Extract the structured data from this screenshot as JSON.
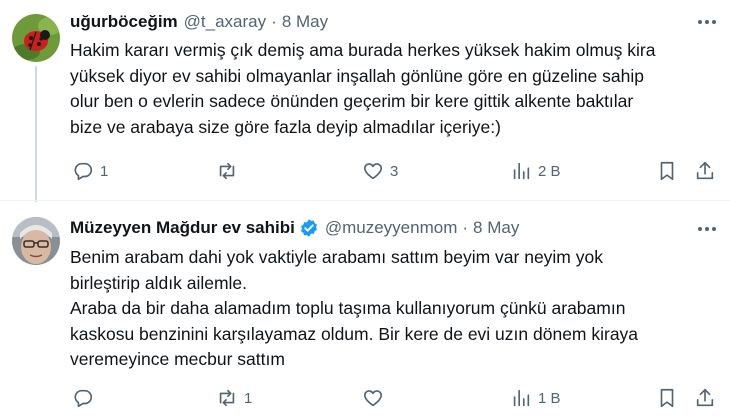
{
  "tweets": [
    {
      "name": "uğurböceğim",
      "handle": "@t_axaray",
      "separator": "·",
      "date": "8 May",
      "verified": false,
      "text": "Hakim kararı vermiş  çık demiş ama burada herkes yüksek hakim olmuş kira\nyüksek diyor ev sahibi olmayanlar inşallah gönlüne göre en güzeline sahip\nolur ben  o evlerin sadece önünden geçerim bir kere gittik alkente baktılar\nbize ve arabaya size göre fazla deyip almadılar içeriye:)",
      "replies": "1",
      "retweets": "",
      "likes": "3",
      "views": "2 B"
    },
    {
      "name": "Müzeyyen Mağdur ev sahibi",
      "handle": "@muzeyyenmom",
      "separator": "·",
      "date": "8 May",
      "verified": true,
      "text": "Benim arabam dahi yok vaktiyle arabamı sattım beyim var neyim yok\nbirleştirip aldık ailemle.\nAraba da bir daha alamadım toplu taşıma kullanıyorum çünkü arabamın\nkaskosu benzinini karşılayamaz oldum. Bir kere de evi uzın dönem kiraya\nveremeyince mecbur sattım",
      "replies": "",
      "retweets": "1",
      "likes": "",
      "views": "1 B"
    }
  ],
  "colors": {
    "text": "#0f1419",
    "secondary": "#536471",
    "verified": "#1d9bf0",
    "divider": "#eff3f4"
  },
  "icons": [
    "ladybug-avatar",
    "user-avatar",
    "verified-badge-icon",
    "more-icon",
    "reply-icon",
    "retweet-icon",
    "like-icon",
    "views-icon",
    "bookmark-icon",
    "share-icon"
  ]
}
